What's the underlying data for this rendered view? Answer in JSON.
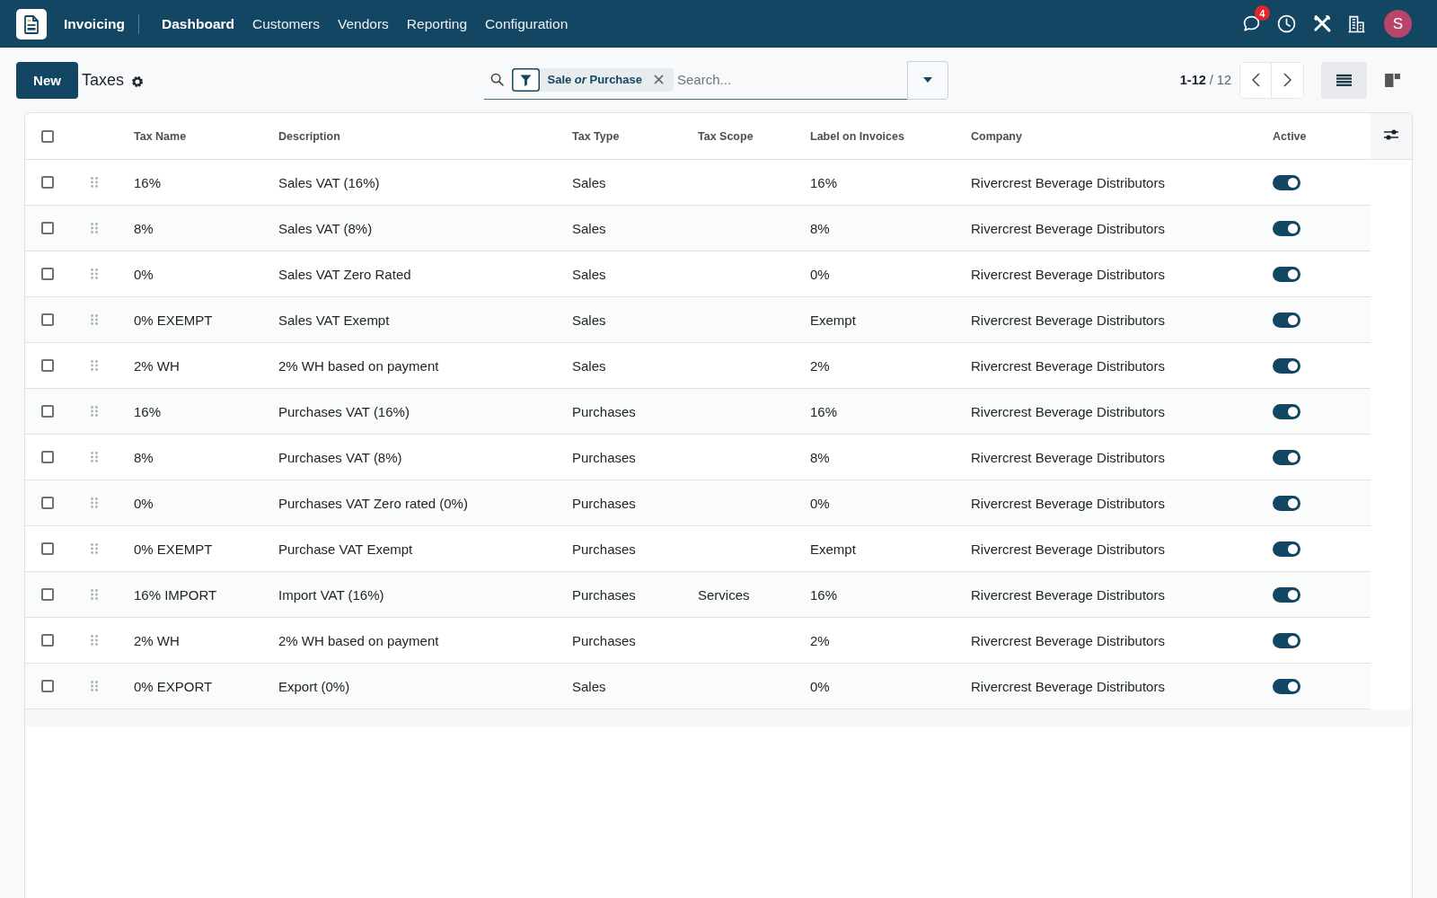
{
  "top_bar": {
    "app_name": "Invoicing",
    "menu": [
      {
        "label": "Dashboard",
        "selected": true
      },
      {
        "label": "Customers",
        "selected": false
      },
      {
        "label": "Vendors",
        "selected": false
      },
      {
        "label": "Reporting",
        "selected": false
      },
      {
        "label": "Configuration",
        "selected": false
      }
    ],
    "notification_count": "4",
    "avatar_initial": "S"
  },
  "control_panel": {
    "new_button": "New",
    "title": "Taxes",
    "search": {
      "facet": "Sale *or* Purchase",
      "placeholder": "Search..."
    },
    "pager": "**1-12** / 12",
    "views": [
      {
        "kind": "list",
        "selected": true
      },
      {
        "kind": "kanban",
        "selected": false
      }
    ]
  },
  "table": {
    "select_all_checked": false,
    "columns": [
      "Tax Name",
      "Description",
      "Tax Type",
      "Tax Scope",
      "Label on Invoices",
      "Company",
      "Active"
    ],
    "rows": [
      {
        "selected": false,
        "tax_name": "16%",
        "description": "Sales VAT (16%)",
        "tax_type": "Sales",
        "label_on_invoices": "16%",
        "company": "Rivercrest Beverage Distributors",
        "active": true
      },
      {
        "selected": false,
        "tax_name": "8%",
        "description": "Sales VAT (8%)",
        "tax_type": "Sales",
        "label_on_invoices": "8%",
        "company": "Rivercrest Beverage Distributors",
        "active": true
      },
      {
        "selected": false,
        "tax_name": "0%",
        "description": "Sales VAT Zero Rated",
        "tax_type": "Sales",
        "label_on_invoices": "0%",
        "company": "Rivercrest Beverage Distributors",
        "active": true
      },
      {
        "selected": false,
        "tax_name": "0% EXEMPT",
        "description": "Sales VAT Exempt",
        "tax_type": "Sales",
        "label_on_invoices": "Exempt",
        "company": "Rivercrest Beverage Distributors",
        "active": true
      },
      {
        "selected": false,
        "tax_name": "2% WH",
        "description": "2% WH based on payment",
        "tax_type": "Sales",
        "label_on_invoices": "2%",
        "company": "Rivercrest Beverage Distributors",
        "active": true
      },
      {
        "selected": false,
        "tax_name": "16%",
        "description": "Purchases VAT (16%)",
        "tax_type": "Purchases",
        "label_on_invoices": "16%",
        "company": "Rivercrest Beverage Distributors",
        "active": true
      },
      {
        "selected": false,
        "tax_name": "8%",
        "description": "Purchases VAT (8%)",
        "tax_type": "Purchases",
        "label_on_invoices": "8%",
        "company": "Rivercrest Beverage Distributors",
        "active": true
      },
      {
        "selected": false,
        "tax_name": "0%",
        "description": "Purchases VAT Zero rated (0%)",
        "tax_type": "Purchases",
        "label_on_invoices": "0%",
        "company": "Rivercrest Beverage Distributors",
        "active": true
      },
      {
        "selected": false,
        "tax_name": "0% EXEMPT",
        "description": "Purchase VAT Exempt",
        "tax_type": "Purchases",
        "label_on_invoices": "Exempt",
        "company": "Rivercrest Beverage Distributors",
        "active": true
      },
      {
        "selected": false,
        "tax_name": "16% IMPORT",
        "description": "Import VAT (16%)",
        "tax_type": "Purchases",
        "tax_scope": "Services",
        "label_on_invoices": "16%",
        "company": "Rivercrest Beverage Distributors",
        "active": true
      },
      {
        "selected": false,
        "tax_name": "2% WH",
        "description": "2% WH based on payment",
        "tax_type": "Purchases",
        "label_on_invoices": "2%",
        "company": "Rivercrest Beverage Distributors",
        "active": true
      },
      {
        "selected": false,
        "tax_name": "0% EXPORT",
        "description": "Export (0%)",
        "tax_type": "Sales",
        "label_on_invoices": "0%",
        "company": "Rivercrest Beverage Distributors",
        "active": true
      }
    ]
  }
}
